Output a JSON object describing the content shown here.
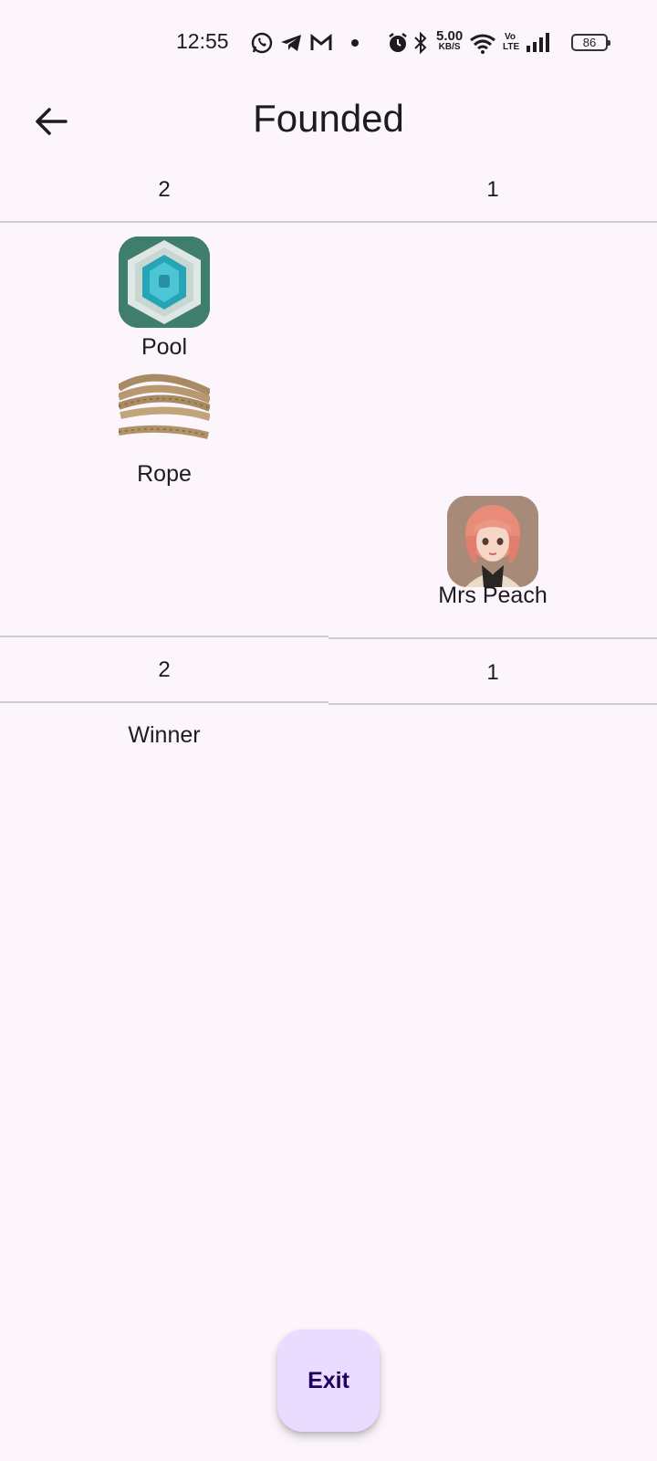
{
  "status_bar": {
    "time": "12:55",
    "speed_value": "5.00",
    "speed_unit": "KB/S",
    "volte": "Vo LTE",
    "battery": "86",
    "icons": [
      "whatsapp-icon",
      "telegram-icon",
      "gmail-icon",
      "dot-icon",
      "alarm-icon",
      "bluetooth-icon",
      "wifi-icon",
      "signal-icon"
    ]
  },
  "app_bar": {
    "title": "Founded",
    "back_icon": "arrow-left-icon"
  },
  "columns": {
    "left_header": "2",
    "right_header": "1",
    "left_footer": "2",
    "right_footer": "1"
  },
  "items": {
    "pool": "Pool",
    "rope": "Rope",
    "character": "Mrs Peach"
  },
  "result": {
    "label": "Winner"
  },
  "actions": {
    "exit_label": "Exit"
  }
}
